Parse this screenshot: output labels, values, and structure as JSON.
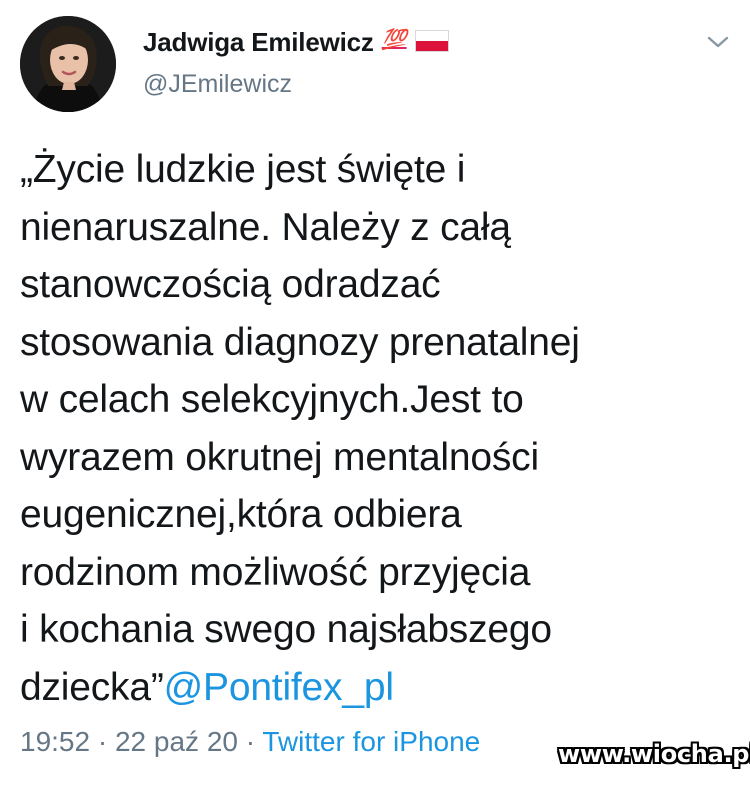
{
  "tweet": {
    "author": {
      "display_name": "Jadwiga Emilewicz",
      "badge_emoji": "💯",
      "flag": "poland-flag-icon",
      "handle": "@JEmilewicz",
      "avatar": "avatar-photo"
    },
    "menu_icon": "chevron-down-icon",
    "text_lines": [
      "„Życie ludzkie jest święte i",
      "nienaruszalne. Należy z całą",
      "stanowczością odradzać",
      "stosowania diagnozy prenatalnej",
      "w celach selekcyjnych.Jest to",
      "wyrazem okrutnej mentalności",
      "eugenicznej,która odbiera",
      "rodzinom możliwość przyjęcia",
      "i kochania swego najsłabszego"
    ],
    "last_line_text": "dziecka”",
    "mention": "@Pontifex_pl",
    "time": "19:52",
    "separator": " · ",
    "date": "22 paź 20",
    "source": "Twitter for iPhone",
    "colors": {
      "text": "#14171a",
      "secondary": "#657786",
      "link": "#1b95e0"
    }
  },
  "watermark": "www.wiocha.pl"
}
